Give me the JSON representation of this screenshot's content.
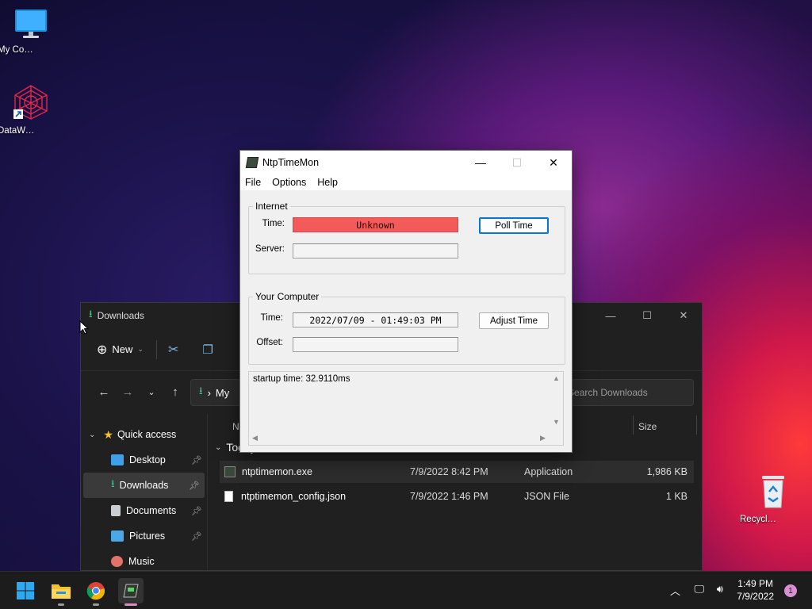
{
  "desktop": {
    "icons": [
      {
        "label": "My Computer"
      },
      {
        "label": "DataWagon..."
      },
      {
        "label": "Recycle Bin"
      }
    ]
  },
  "explorer": {
    "title": "Downloads",
    "new_label": "New",
    "address_text": "My",
    "search_placeholder": "Search Downloads",
    "col_name": "Na",
    "col_size": "Size",
    "group_label": "Today",
    "sidebar": [
      {
        "label": "Quick access",
        "icon": "star-icon"
      },
      {
        "label": "Desktop",
        "icon": "desktop-folder-icon"
      },
      {
        "label": "Downloads",
        "icon": "download-icon"
      },
      {
        "label": "Documents",
        "icon": "documents-icon"
      },
      {
        "label": "Pictures",
        "icon": "pictures-icon"
      },
      {
        "label": "Music",
        "icon": "music-icon"
      }
    ],
    "files": [
      {
        "name": "ntptimemon.exe",
        "date": "7/9/2022 8:42 PM",
        "type": "Application",
        "size": "1,986 KB"
      },
      {
        "name": "ntptimemon_config.json",
        "date": "7/9/2022 1:46 PM",
        "type": "JSON File",
        "size": "1 KB"
      }
    ]
  },
  "ntp": {
    "title": "NtpTimeMon",
    "menu": [
      "File",
      "Options",
      "Help"
    ],
    "internet": {
      "group_label": "Internet",
      "time_label": "Time:",
      "time_value": "Unknown",
      "server_label": "Server:",
      "server_value": "",
      "poll_button": "Poll Time"
    },
    "computer": {
      "group_label": "Your Computer",
      "time_label": "Time:",
      "time_value": "2022/07/09 - 01:49:03 PM",
      "offset_label": "Offset:",
      "offset_value": "",
      "adjust_button": "Adjust Time"
    },
    "log": "startup time: 32.9110ms",
    "status_color_unknown": "#f45a5a"
  },
  "taskbar": {
    "time": "1:49 PM",
    "date": "7/9/2022",
    "notifications": "1",
    "pinned": [
      "start-icon",
      "file-explorer-icon",
      "chrome-icon",
      "ntptimemon-icon"
    ]
  }
}
